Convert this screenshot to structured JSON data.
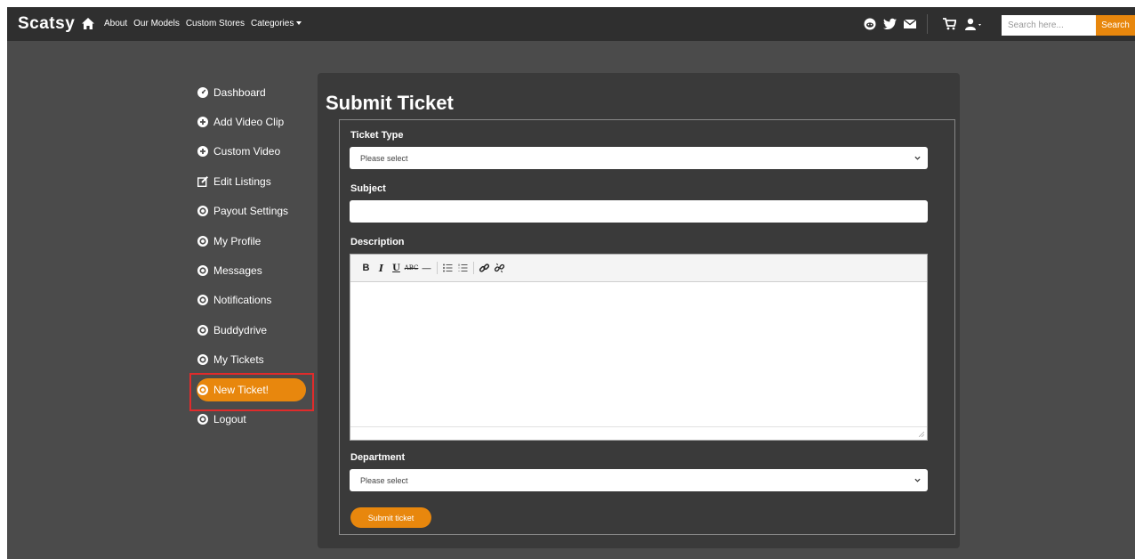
{
  "header": {
    "logo": "Scatsy",
    "nav": [
      {
        "label": "About"
      },
      {
        "label": "Our Models"
      },
      {
        "label": "Custom Stores"
      },
      {
        "label": "Categories"
      }
    ],
    "search": {
      "placeholder": "Search here...",
      "button_label": "Search"
    },
    "icons": [
      "home-icon",
      "reddit-icon",
      "twitter-icon",
      "mail-icon",
      "cart-icon",
      "user-icon"
    ]
  },
  "sidebar": {
    "items": [
      {
        "label": "Dashboard",
        "icon": "dashboard-icon"
      },
      {
        "label": "Add Video Clip",
        "icon": "plus-circle-icon"
      },
      {
        "label": "Custom Video",
        "icon": "plus-circle-icon"
      },
      {
        "label": "Edit Listings",
        "icon": "edit-icon"
      },
      {
        "label": "Payout Settings",
        "icon": "target-icon"
      },
      {
        "label": "My Profile",
        "icon": "target-icon"
      },
      {
        "label": "Messages",
        "icon": "target-icon"
      },
      {
        "label": "Notifications",
        "icon": "target-icon"
      },
      {
        "label": "Buddydrive",
        "icon": "target-icon"
      },
      {
        "label": "My Tickets",
        "icon": "target-icon"
      },
      {
        "label": "New Ticket!",
        "icon": "target-icon",
        "active": true
      },
      {
        "label": "Logout",
        "icon": "target-icon"
      }
    ]
  },
  "form": {
    "title": "Submit Ticket",
    "ticket_type": {
      "label": "Ticket Type",
      "value": "Please select"
    },
    "subject": {
      "label": "Subject",
      "value": ""
    },
    "description": {
      "label": "Description",
      "toolbar": [
        "bold",
        "italic",
        "underline",
        "strikethrough",
        "horizontal-rule",
        "bulleted-list",
        "numbered-list",
        "link",
        "unlink"
      ]
    },
    "department": {
      "label": "Department",
      "value": "Please select"
    },
    "submit_label": "Submit ticket"
  },
  "colors": {
    "accent": "#e8870d",
    "topbar": "#2f2f2f",
    "background": "#4b4b4b",
    "panel": "#3a3a3a",
    "highlight": "#e02b2b"
  }
}
